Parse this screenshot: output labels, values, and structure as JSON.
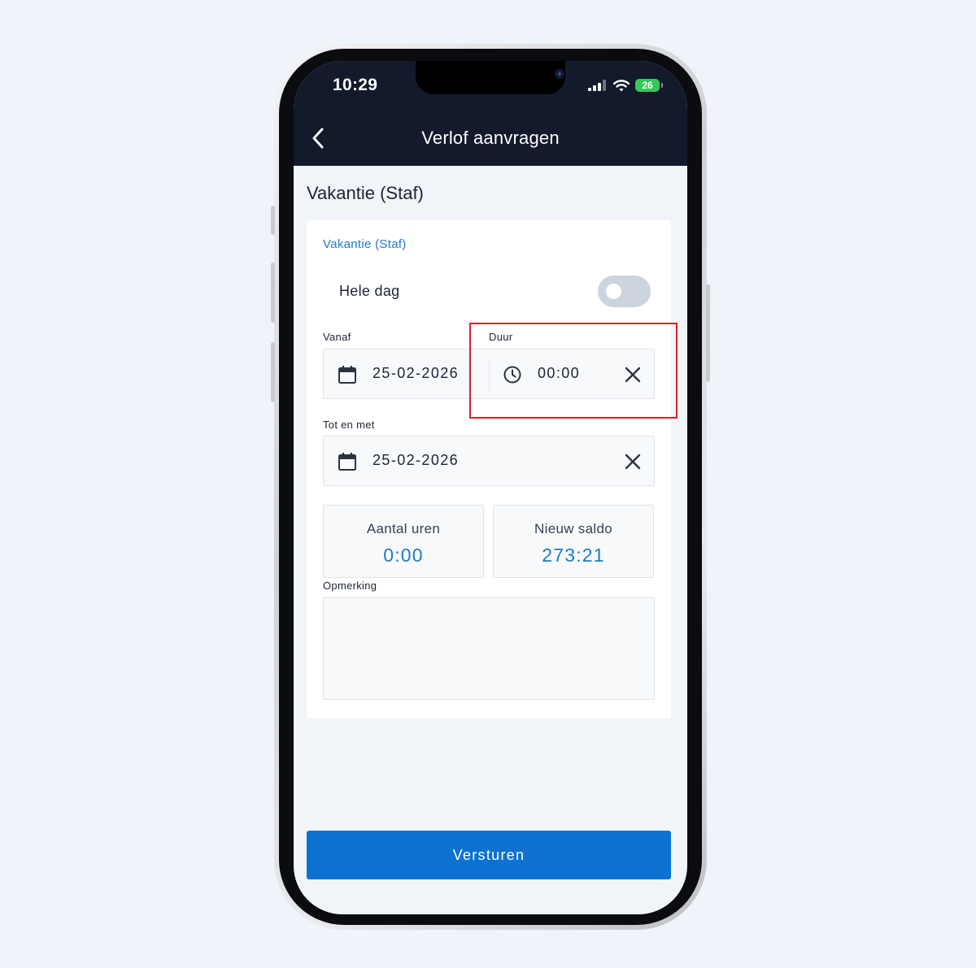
{
  "status_bar": {
    "time": "10:29",
    "battery": "26"
  },
  "header": {
    "title": "Verlof aanvragen"
  },
  "page_title": "Vakantie (Staf)",
  "form": {
    "type_label": "Vakantie (Staf)",
    "all_day": {
      "label": "Hele dag",
      "checked": false
    },
    "from": {
      "label": "Vanaf",
      "value": "25-02-2026"
    },
    "duration": {
      "label": "Duur",
      "value": "00:00"
    },
    "until": {
      "label": "Tot en met",
      "value": "25-02-2026"
    },
    "hours": {
      "label": "Aantal uren",
      "value": "0:00"
    },
    "balance": {
      "label": "Nieuw saldo",
      "value": "273:21"
    },
    "remark": {
      "label": "Opmerking",
      "value": ""
    }
  },
  "submit_label": "Versturen",
  "colors": {
    "header_bg": "#121a2c",
    "accent": "#1f7ac6",
    "button": "#0b72d1",
    "highlight": "#d9212b"
  },
  "icons": [
    "back-arrow-icon",
    "calendar-icon",
    "clock-icon",
    "close-icon",
    "signal-icon",
    "wifi-icon",
    "battery-icon"
  ]
}
